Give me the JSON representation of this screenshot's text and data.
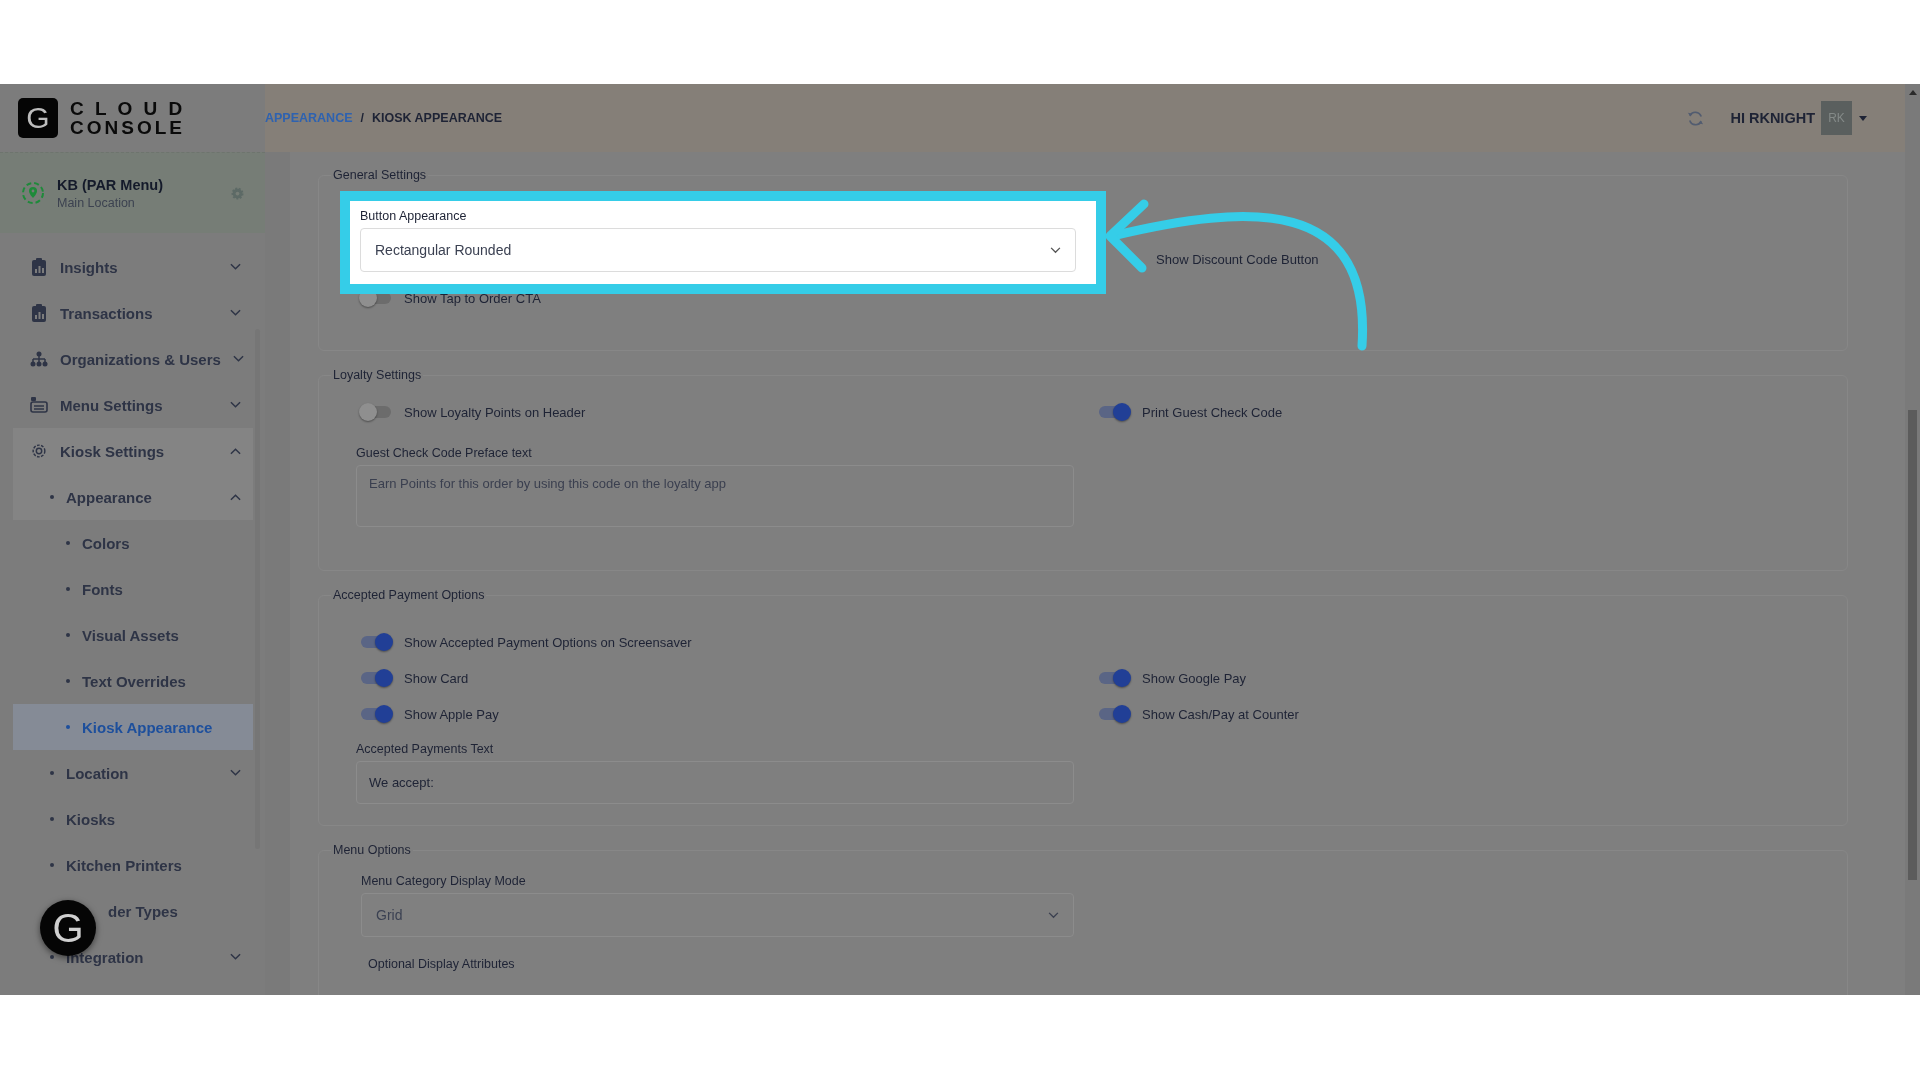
{
  "logo": {
    "mark": "G",
    "line1": "C L O U D",
    "line2": "CONSOLE"
  },
  "location": {
    "name": "KB (PAR Menu)",
    "subtitle": "Main Location"
  },
  "nav": [
    {
      "label": "Insights",
      "expanded": false,
      "selected": false
    },
    {
      "label": "Transactions",
      "expanded": false,
      "selected": false
    },
    {
      "label": "Organizations & Users",
      "expanded": false,
      "selected": false
    },
    {
      "label": "Menu Settings",
      "expanded": false,
      "selected": false
    },
    {
      "label": "Kiosk Settings",
      "expanded": true,
      "selected": false,
      "children": [
        {
          "label": "Appearance",
          "expanded": true,
          "selected": false,
          "children": [
            {
              "label": "Colors",
              "selected": false
            },
            {
              "label": "Fonts",
              "selected": false
            },
            {
              "label": "Visual Assets",
              "selected": false
            },
            {
              "label": "Text Overrides",
              "selected": false
            },
            {
              "label": "Kiosk Appearance",
              "selected": true
            }
          ]
        },
        {
          "label": "Location",
          "expanded": false,
          "selected": false
        },
        {
          "label": "Kiosks",
          "selected": false
        },
        {
          "label": "Kitchen Printers",
          "selected": false
        },
        {
          "label": "der Types",
          "selected": false
        },
        {
          "label": "Integration",
          "expanded": false,
          "selected": false
        }
      ]
    }
  ],
  "help_button": {
    "label": "G"
  },
  "breadcrumb": [
    {
      "label": "APPEARANCE",
      "link": true
    },
    {
      "label": "KIOSK APPEARANCE",
      "link": false
    }
  ],
  "breadcrumb_separator": "/",
  "user": {
    "greeting": "HI RKNIGHT",
    "initials": "RK"
  },
  "general_settings": {
    "title": "General Settings",
    "button_appearance": {
      "label": "Button Appearance",
      "value": "Rectangular Rounded",
      "highlighted": true
    },
    "discount_code_button": {
      "label": "Show Discount Code Button"
    },
    "tap_to_order": {
      "label": "Show Tap to Order CTA",
      "on": false
    }
  },
  "loyalty_settings": {
    "title": "Loyalty Settings",
    "toggles": [
      {
        "label": "Show Loyalty Points on Header",
        "on": false
      },
      {
        "label": "Print Guest Check Code",
        "on": true
      }
    ],
    "preface": {
      "label": "Guest Check Code Preface text",
      "value": "Earn Points for this order by using this code on the loyalty app"
    }
  },
  "payment_options": {
    "title": "Accepted Payment Options",
    "toggles": [
      {
        "label": "Show Accepted Payment Options on Screensaver",
        "on": true
      },
      {
        "label": "Show Card",
        "on": true
      },
      {
        "label": "Show Google Pay",
        "on": true
      },
      {
        "label": "Show Apple Pay",
        "on": true
      },
      {
        "label": "Show Cash/Pay at Counter",
        "on": true
      }
    ],
    "payments_text": {
      "label": "Accepted Payments Text",
      "value": "We accept:"
    }
  },
  "menu_options": {
    "title": "Menu Options",
    "display_mode": {
      "label": "Menu Category Display Mode",
      "value": "Grid"
    },
    "optional_attributes": {
      "label": "Optional Display Attributes"
    }
  }
}
